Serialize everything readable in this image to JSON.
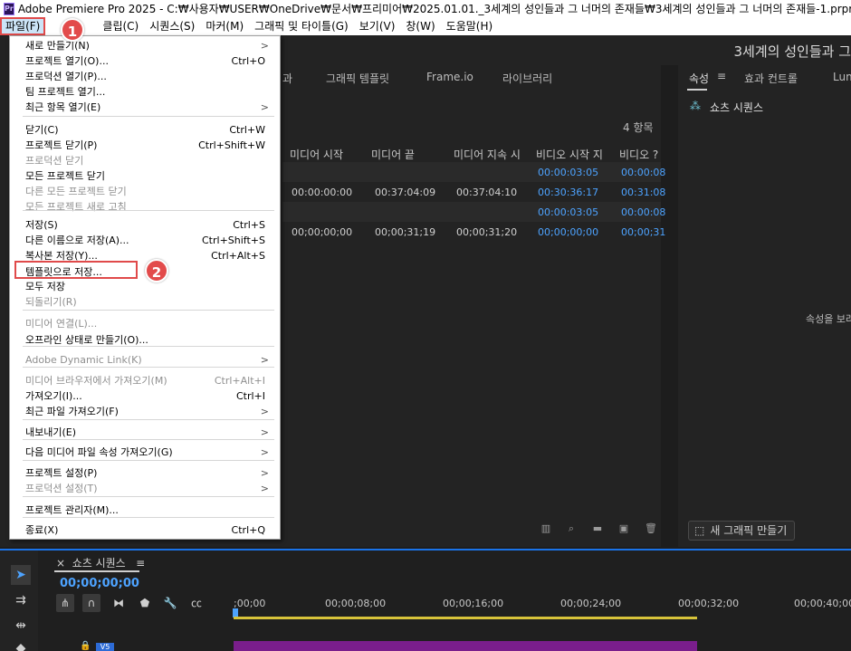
{
  "window": {
    "app_icon": "Pr",
    "title": "Adobe Premiere Pro 2025 - C:₩사용자₩USER₩OneDrive₩문서₩프리미어₩2025.01.01._3세계의 성인들과 그 너머의 존재들₩3세계의 성인들과 그 너머의 존재들-1.prproj"
  },
  "menubar": [
    "파일(F)",
    "편",
    "클립(C)",
    "시퀀스(S)",
    "마커(M)",
    "그래픽 및 타이틀(G)",
    "보기(V)",
    "창(W)",
    "도움말(H)"
  ],
  "project_title": "3세계의 성인들과 그",
  "left_panel": {
    "tabs": [
      "과",
      "그래픽 템플릿",
      "Frame.io",
      "라이브러리"
    ],
    "item_count": "4 항목",
    "columns": [
      "미디어 시작",
      "미디어 끝",
      "미디어 지속 시",
      "비디오 시작 지",
      "비디오 ?"
    ],
    "rows": [
      [
        "",
        "",
        "",
        "00:00:03:05",
        "00:00:08"
      ],
      [
        "00:00:00:00",
        "00:37:04:09",
        "00:37:04:10",
        "00:30:36:17",
        "00:31:08"
      ],
      [
        "",
        "",
        "",
        "00:00:03:05",
        "00:00:08"
      ],
      [
        "00;00;00;00",
        "00;00;31;19",
        "00;00;31;20",
        "00;00;00;00",
        "00;00;31"
      ]
    ]
  },
  "right_panel": {
    "tabs": [
      "속성",
      "효과 컨트롤",
      "Lum"
    ],
    "source_sequence": "쇼츠 시퀀스",
    "hint": "속성을 보려",
    "new_graphic_button": "새 그래픽 만들기"
  },
  "timeline": {
    "sequence_tab": "쇼츠 시퀀스",
    "timecode": "00;00;00;00",
    "ruler": [
      ";00;00",
      "00;00;08;00",
      "00;00;16;00",
      "00;00;24;00",
      "00;00;32;00",
      "00;00;40;00"
    ],
    "track_label": "V5"
  },
  "file_menu": {
    "items": [
      {
        "label": "새로 만들기(N)",
        "shortcut": "",
        "submenu": true,
        "disabled": false
      },
      {
        "label": "프로젝트 열기(O)...",
        "shortcut": "Ctrl+O",
        "submenu": false,
        "disabled": false
      },
      {
        "label": "프로덕션 열기(P)...",
        "shortcut": "",
        "submenu": false,
        "disabled": false
      },
      {
        "label": "팀 프로젝트 열기...",
        "shortcut": "",
        "submenu": false,
        "disabled": false
      },
      {
        "label": "최근 항목 열기(E)",
        "shortcut": "",
        "submenu": true,
        "disabled": false
      },
      {
        "label": "닫기(C)",
        "shortcut": "Ctrl+W",
        "submenu": false,
        "disabled": false
      },
      {
        "label": "프로젝트 닫기(P)",
        "shortcut": "Ctrl+Shift+W",
        "submenu": false,
        "disabled": false
      },
      {
        "label": "프로덕션 닫기",
        "shortcut": "",
        "submenu": false,
        "disabled": true
      },
      {
        "label": "모든 프로젝트 닫기",
        "shortcut": "",
        "submenu": false,
        "disabled": false
      },
      {
        "label": "다른 모든 프로젝트 닫기",
        "shortcut": "",
        "submenu": false,
        "disabled": true
      },
      {
        "label": "모든 프로젝트 새로 고침",
        "shortcut": "",
        "submenu": false,
        "disabled": true
      },
      {
        "label": "저장(S)",
        "shortcut": "Ctrl+S",
        "submenu": false,
        "disabled": false
      },
      {
        "label": "다른 이름으로 저장(A)...",
        "shortcut": "Ctrl+Shift+S",
        "submenu": false,
        "disabled": false
      },
      {
        "label": "복사본 저장(Y)...",
        "shortcut": "Ctrl+Alt+S",
        "submenu": false,
        "disabled": false
      },
      {
        "label": "템플릿으로 저장...",
        "shortcut": "",
        "submenu": false,
        "disabled": false
      },
      {
        "label": "모두 저장",
        "shortcut": "",
        "submenu": false,
        "disabled": false
      },
      {
        "label": "되돌리기(R)",
        "shortcut": "",
        "submenu": false,
        "disabled": true
      },
      {
        "label": "미디어 연결(L)...",
        "shortcut": "",
        "submenu": false,
        "disabled": true
      },
      {
        "label": "오프라인 상태로 만들기(O)...",
        "shortcut": "",
        "submenu": false,
        "disabled": false
      },
      {
        "label": "Adobe Dynamic Link(K)",
        "shortcut": "",
        "submenu": true,
        "disabled": true
      },
      {
        "label": "미디어 브라우저에서 가져오기(M)",
        "shortcut": "Ctrl+Alt+I",
        "submenu": false,
        "disabled": true
      },
      {
        "label": "가져오기(I)...",
        "shortcut": "Ctrl+I",
        "submenu": false,
        "disabled": false
      },
      {
        "label": "최근 파일 가져오기(F)",
        "shortcut": "",
        "submenu": true,
        "disabled": false
      },
      {
        "label": "내보내기(E)",
        "shortcut": "",
        "submenu": true,
        "disabled": false
      },
      {
        "label": "다음 미디어 파일 속성 가져오기(G)",
        "shortcut": "",
        "submenu": true,
        "disabled": false
      },
      {
        "label": "프로젝트 설정(P)",
        "shortcut": "",
        "submenu": true,
        "disabled": false
      },
      {
        "label": "프로덕션 설정(T)",
        "shortcut": "",
        "submenu": true,
        "disabled": true
      },
      {
        "label": "프로젝트 관리자(M)...",
        "shortcut": "",
        "submenu": false,
        "disabled": false
      },
      {
        "label": "종료(X)",
        "shortcut": "Ctrl+Q",
        "submenu": false,
        "disabled": false
      }
    ]
  },
  "annotations": {
    "step1": "1",
    "step2": "2"
  },
  "icons": {
    "submenu_arrow": ">",
    "accent_blue": "#4da3ff",
    "highlight_red": "#e04a4a",
    "clip_purple": "#7a1e8c"
  }
}
